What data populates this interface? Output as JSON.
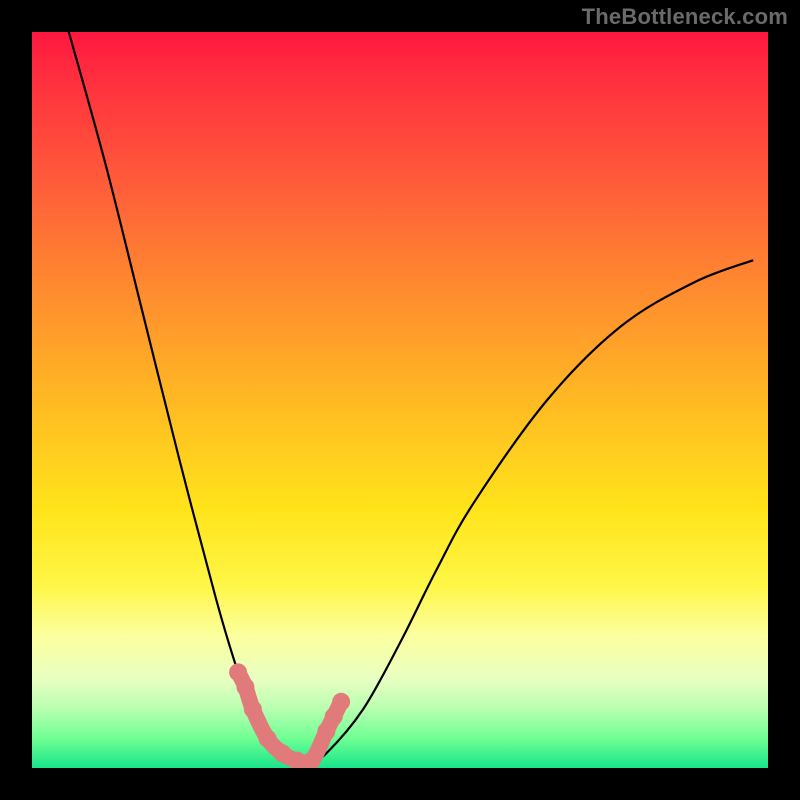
{
  "watermark": {
    "text": "TheBottleneck.com"
  },
  "colors": {
    "background": "#000000",
    "curve": "#000000",
    "marker": "#e17b7b",
    "gradient_stops": [
      "#ff173f",
      "#ff5a3a",
      "#ffb923",
      "#fff646",
      "#e8ffc2",
      "#17e58a"
    ]
  },
  "chart_data": {
    "type": "line",
    "title": "",
    "xlabel": "",
    "ylabel": "",
    "xlim": [
      0,
      100
    ],
    "ylim": [
      0,
      100
    ],
    "grid": false,
    "legend": false,
    "series": [
      {
        "name": "bottleneck-curve",
        "x": [
          5,
          10,
          15,
          20,
          25,
          28,
          30,
          32,
          34,
          36,
          38,
          40,
          45,
          50,
          55,
          60,
          70,
          80,
          90,
          98
        ],
        "values": [
          100,
          82,
          62,
          42,
          23,
          13,
          8,
          4,
          2,
          1,
          1,
          2,
          8,
          17,
          27,
          36,
          50,
          60,
          66,
          69
        ]
      }
    ],
    "markers": {
      "name": "highlighted-points",
      "x": [
        28,
        29,
        30,
        32,
        34,
        36,
        38,
        40,
        41,
        42
      ],
      "values": [
        13,
        11,
        8,
        4,
        2,
        1,
        1,
        5,
        7,
        9
      ]
    }
  }
}
